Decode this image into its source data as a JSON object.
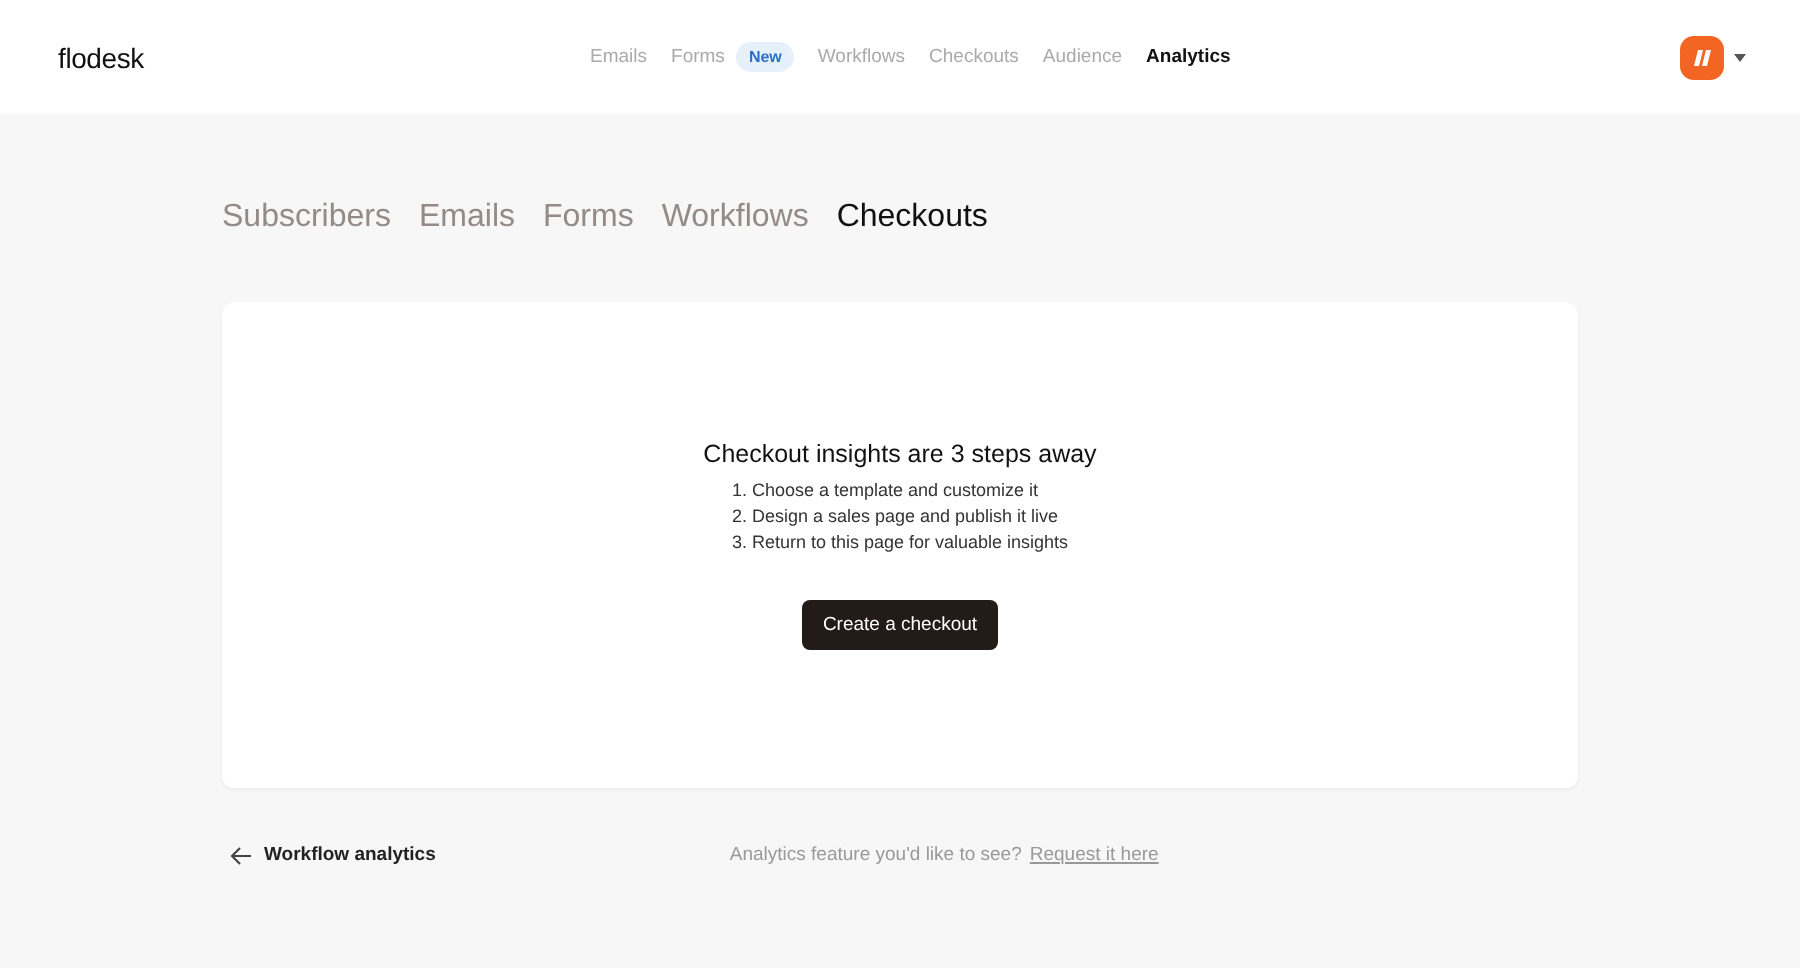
{
  "brand": "flodesk",
  "nav": [
    {
      "label": "Emails",
      "selected": false
    },
    {
      "label": "Forms",
      "selected": false,
      "badge": "New"
    },
    {
      "label": "Workflows",
      "selected": false
    },
    {
      "label": "Checkouts",
      "selected": false
    },
    {
      "label": "Audience",
      "selected": false
    },
    {
      "label": "Analytics",
      "selected": true
    }
  ],
  "tabs": [
    {
      "label": "Subscribers",
      "selected": false
    },
    {
      "label": "Emails",
      "selected": false
    },
    {
      "label": "Forms",
      "selected": false
    },
    {
      "label": "Workflows",
      "selected": false
    },
    {
      "label": "Checkouts",
      "selected": true
    }
  ],
  "empty_state": {
    "title": "Checkout insights are 3 steps away",
    "steps": [
      "1. Choose a template and customize it",
      "2. Design a sales page and publish it live",
      "3. Return to this page for valuable insights"
    ],
    "button": "Create a checkout"
  },
  "footer": {
    "back_link": "Workflow analytics",
    "prompt": "Analytics feature you'd like to see?",
    "request_link": "Request it here"
  }
}
